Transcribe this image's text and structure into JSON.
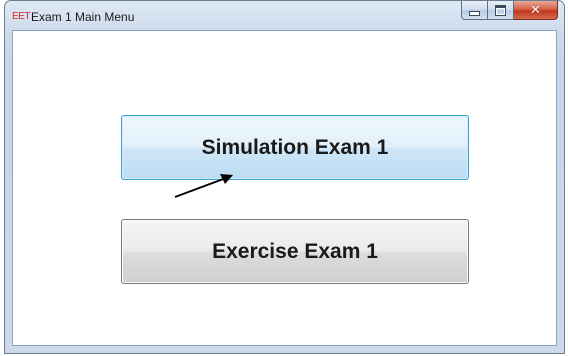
{
  "window": {
    "icon_text": "EET",
    "title": "Exam 1 Main Menu"
  },
  "caption_buttons": {
    "minimize_icon": "minimize-icon",
    "maximize_icon": "maximize-icon",
    "close_icon": "close-icon",
    "close_glyph": "✕"
  },
  "menu": {
    "simulation_label": "Simulation Exam 1",
    "exercise_label": "Exercise Exam 1"
  },
  "colors": {
    "close_button": "#c8402a",
    "focused_button_border": "#3c9fd9",
    "icon_text": "#d42b2b"
  }
}
